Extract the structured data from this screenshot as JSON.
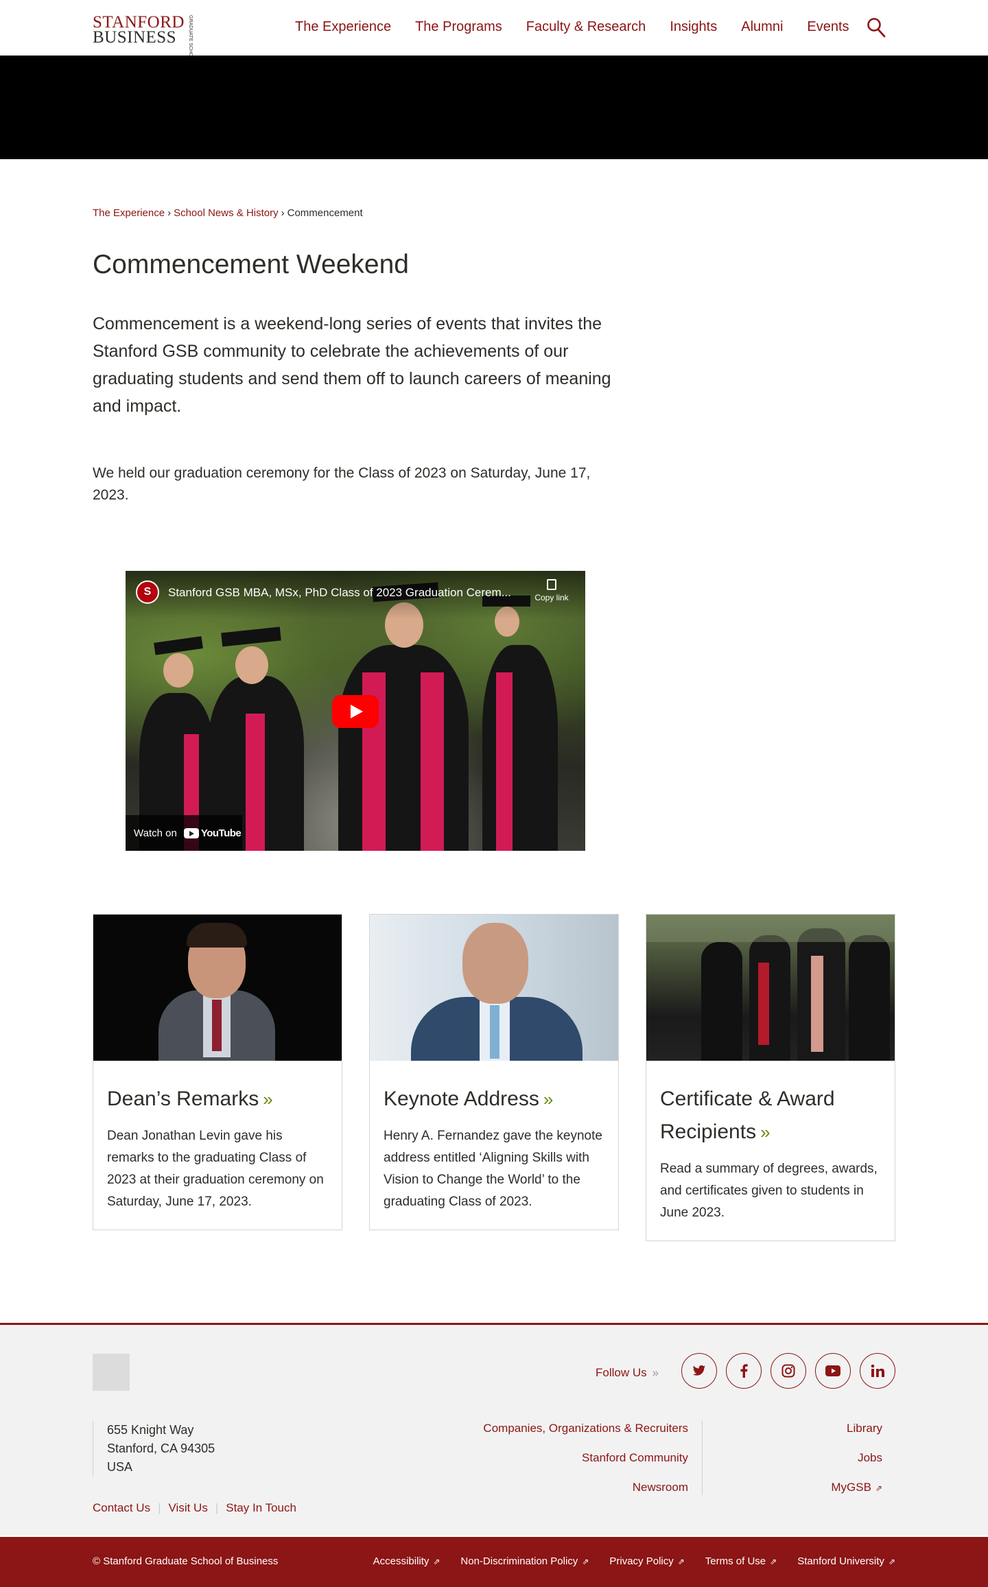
{
  "header": {
    "logo_line1": "STANFORD",
    "logo_line2": "BUSINESS",
    "logo_side": "GRADUATE SCHOOL OF",
    "nav": [
      "The Experience",
      "The Programs",
      "Faculty & Research",
      "Insights",
      "Alumni",
      "Events"
    ]
  },
  "breadcrumb": {
    "items": [
      "The Experience",
      "School News & History"
    ],
    "separator": "›",
    "current": "Commencement"
  },
  "page": {
    "title": "Commencement Weekend",
    "intro": "Commencement is a weekend-long series of events that invites the Stanford GSB community to celebrate the achievements of our graduating students and send them off to launch careers of meaning and impact.",
    "note": "We held our graduation ceremony for the Class of 2023 on Saturday, June 17, 2023."
  },
  "video": {
    "channel_initials": "S",
    "title": "Stanford GSB MBA, MSx, PhD Class of 2023 Graduation Cerem...",
    "copy_link": "Copy link",
    "watch_on": "Watch on",
    "youtube": "YouTube"
  },
  "cards": [
    {
      "title": "Dean’s Remarks",
      "chevron": "»",
      "text": "Dean Jonathan Levin gave his remarks to the graduating Class of 2023 at their graduation ceremony on Saturday, June 17, 2023."
    },
    {
      "title": "Keynote Address",
      "chevron": "»",
      "text": "Henry A. Fernandez gave the keynote address entitled ‘Aligning Skills with Vision to Change the World’ to the graduating Class of 2023."
    },
    {
      "title": "Certificate & Award Recipients",
      "chevron": "»",
      "text": "Read a summary of degrees, awards, and certificates given to students in June 2023."
    }
  ],
  "footer": {
    "follow_us": "Follow Us",
    "follow_chevron": "»",
    "social": [
      "twitter-icon",
      "facebook-icon",
      "instagram-icon",
      "youtube-icon",
      "linkedin-icon"
    ],
    "address": [
      "655 Knight Way",
      "Stanford, CA 94305",
      "USA"
    ],
    "links_mid": [
      "Companies, Organizations & Recruiters",
      "Stanford Community",
      "Newsroom"
    ],
    "links_right": [
      "Library",
      "Jobs",
      "MyGSB"
    ],
    "bottom_links": [
      "Contact Us",
      "Visit Us",
      "Stay In Touch"
    ],
    "copyright": "© Stanford Graduate School of Business",
    "global_links": [
      "Accessibility",
      "Non-Discrimination Policy",
      "Privacy Policy",
      "Terms of Use",
      "Stanford University"
    ],
    "external_glyph": "⇗"
  },
  "colors": {
    "brand": "#8c1515",
    "chevron_green": "#6a8a10"
  }
}
